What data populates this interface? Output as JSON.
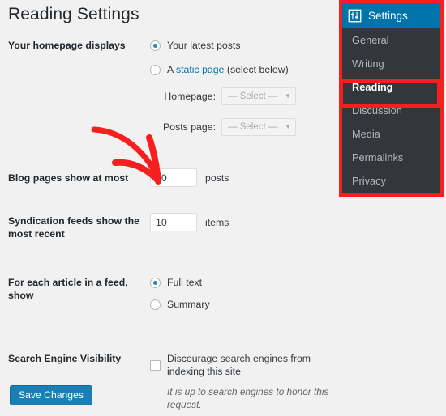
{
  "page": {
    "title": "Reading Settings",
    "background_color": "#f1f1f1"
  },
  "form": {
    "homepage": {
      "label": "Your homepage displays",
      "options": [
        {
          "label": "Your latest posts",
          "selected": true
        },
        {
          "label_prefix": "A ",
          "link_text": "static page",
          "label_suffix": " (select below)",
          "selected": false
        }
      ],
      "selects": [
        {
          "caption": "Homepage:",
          "value": "— Select —",
          "disabled": true
        },
        {
          "caption": "Posts page:",
          "value": "— Select —",
          "disabled": true
        }
      ]
    },
    "blog_pages": {
      "label": "Blog pages show at most",
      "value": "10",
      "suffix": "posts"
    },
    "syndication": {
      "label": "Syndication feeds show the most recent",
      "value": "10",
      "suffix": "items"
    },
    "feed_article": {
      "label": "For each article in a feed, show",
      "options": [
        {
          "label": "Full text",
          "selected": true
        },
        {
          "label": "Summary",
          "selected": false
        }
      ]
    },
    "search_visibility": {
      "label": "Search Engine Visibility",
      "checkbox_label": "Discourage search engines from indexing this site",
      "checked": false,
      "hint": "It is up to search engines to honor this request."
    },
    "save_label": "Save Changes"
  },
  "sidebar": {
    "header": {
      "label": "Settings",
      "icon": "settings-sliders-icon",
      "background_color": "#0073aa"
    },
    "background_color": "#32373c",
    "items": [
      {
        "label": "General",
        "current": false
      },
      {
        "label": "Writing",
        "current": false
      },
      {
        "label": "Reading",
        "current": true
      },
      {
        "label": "Discussion",
        "current": false
      },
      {
        "label": "Media",
        "current": false
      },
      {
        "label": "Permalinks",
        "current": false
      },
      {
        "label": "Privacy",
        "current": false
      }
    ]
  },
  "annotations": {
    "color": "#f61f1f",
    "arrow": "curved-arrow-pointing-to-blog-pages-input",
    "highlight_box": "reading-menu-item",
    "outer_box": "settings-submenu"
  }
}
